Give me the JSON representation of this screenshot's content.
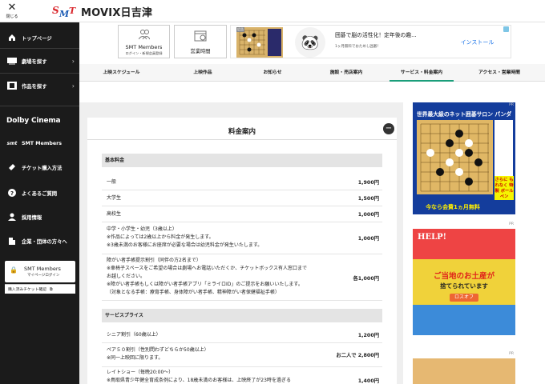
{
  "header": {
    "close_label": "閉じる",
    "title": "MOVIX日吉津",
    "logo_text": "SMT"
  },
  "sidebar": {
    "items": [
      {
        "label": "トップページ",
        "icon": "home-icon"
      },
      {
        "label": "劇場を探す",
        "icon": "theater-icon"
      },
      {
        "label": "作品を探す",
        "icon": "film-icon"
      },
      {
        "label": "Dolby Cinema"
      },
      {
        "label": "SMT Members",
        "icon": "smt-icon"
      },
      {
        "label": "チケット購入方法",
        "icon": "ticket-icon"
      },
      {
        "label": "よくあるご質問",
        "icon": "question-icon"
      },
      {
        "label": "採用情報",
        "icon": "person-icon"
      },
      {
        "label": "企業・団体の方々へ",
        "icon": "building-icon"
      }
    ],
    "members_box": {
      "title": "SMT Members",
      "subtitle": "マイページログイン"
    },
    "ticket_link": "購入済みチケット確認"
  },
  "banners": {
    "members": {
      "title": "SMT Members",
      "subtitle": "ログイン・新規会員登録"
    },
    "hours": {
      "title": "営業時間"
    }
  },
  "ad_top": {
    "pr": "広告",
    "headline": "囲碁で脳の活性化！定年後の趣...",
    "sub": "1ヶ月無料でおためし囲碁！",
    "cta": "インストール"
  },
  "tabs": [
    {
      "label": "上映スケジュール",
      "active": false
    },
    {
      "label": "上映作品",
      "active": false
    },
    {
      "label": "お知らせ",
      "active": false
    },
    {
      "label": "施設・売店案内",
      "active": false
    },
    {
      "label": "サービス・料金案内",
      "active": true
    },
    {
      "label": "アクセス・営業時間",
      "active": false
    }
  ],
  "pricing": {
    "title": "料金案内",
    "basic": {
      "heading": "基本料金",
      "rows": [
        {
          "lines": [
            "一般"
          ],
          "price": "1,900円"
        },
        {
          "lines": [
            "大学生"
          ],
          "price": "1,500円"
        },
        {
          "lines": [
            "高校生"
          ],
          "price": "1,000円"
        },
        {
          "lines": [
            "中学・小学生・幼児（3歳以上）",
            "※作品によっては2歳以上から料金が発生します。",
            "※3歳未満のお客様にお座席が必要な場合は幼児料金が発生いたします。"
          ],
          "price": "1,000円"
        },
        {
          "lines": [
            "障がい者手帳提示割引（同伴の方2名まで）",
            "※車椅子スペースをご希望の場合は劇場へお電話いただくか、チケットボックス有人窓口まで",
            "お越しください。",
            "※障がい者手帳もしくは障がい者手帳アプリ「ミライロID」のご提示をお願いいたします。",
            "（対象となる手帳：療育手帳、身体障がい者手帳、精神障がい者保健福祉手帳）"
          ],
          "price": "各1,000円"
        }
      ]
    },
    "service": {
      "heading": "サービスプライス",
      "rows": [
        {
          "lines": [
            "シニア割引（60歳以上）"
          ],
          "price": "1,200円"
        },
        {
          "lines": [
            "ペア５０割引（性別問わずどちらか50歳以上）",
            "※同一上映回に限ります。"
          ],
          "price": "お二人で 2,800円"
        },
        {
          "lines": [
            "レイトショー（毎晩20:00～）",
            "※鳥取県青少年健全育成条例により、18歳未満のお客様は、上映終了が23時を過ぎる"
          ],
          "price": "1,400円"
        }
      ]
    }
  },
  "ads_right": {
    "ad1": {
      "pr": "PR",
      "headline": "世界最大級のネット囲碁サロン パンダネット",
      "pen": "さらに もれなく 特製 ボールペン",
      "footer": "今なら会費1ヵ月無料"
    },
    "ad2": {
      "pr": "PR",
      "help": "HELP!",
      "line1": "ご当地のお土産が",
      "line2": "捨てられています",
      "logo": "ロスオフ"
    },
    "ad3": {
      "pr": "PR"
    }
  },
  "colors": {
    "accent": "#1a9e7a",
    "sidebar_bg": "#1b1b1b",
    "ad_blue": "#143d9c"
  }
}
